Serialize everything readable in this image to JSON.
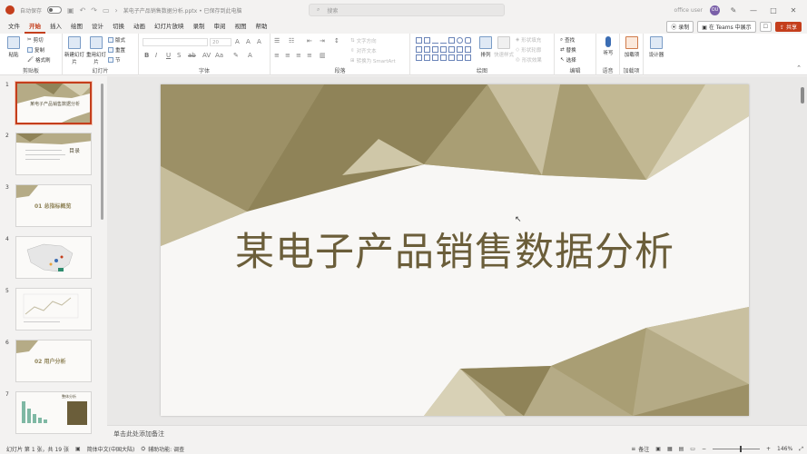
{
  "titlebar": {
    "autosave_label": "自动保存",
    "autosave_state": "关",
    "doc_title": "某电子产品销售数据分析.pptx • 已保存到此电脑",
    "search_placeholder": "搜索",
    "user_name": "office user",
    "user_initials": "OU"
  },
  "tabs": [
    "文件",
    "开始",
    "插入",
    "绘图",
    "设计",
    "切换",
    "动画",
    "幻灯片放映",
    "录制",
    "审阅",
    "视图",
    "帮助"
  ],
  "active_tab": "开始",
  "tab_actions": {
    "record": "录制",
    "teams": "在 Teams 中展示",
    "share": "共享"
  },
  "ribbon": {
    "clipboard": {
      "label": "剪贴板",
      "paste": "粘贴",
      "cut": "剪切",
      "copy": "复制",
      "format_painter": "格式刷"
    },
    "slides": {
      "label": "幻灯片",
      "new_slide": "新建幻灯片",
      "reuse": "重用幻灯片",
      "layout": "版式",
      "reset": "重置",
      "section": "节"
    },
    "font": {
      "label": "字体",
      "size_value": "20"
    },
    "paragraph": {
      "label": "段落",
      "text_direction": "文字方向",
      "align_text": "对齐文本",
      "smartart": "转换为 SmartArt"
    },
    "drawing": {
      "label": "绘图",
      "arrange": "排列",
      "quick_styles": "快速样式",
      "shape_fill": "形状填充",
      "shape_outline": "形状轮廓",
      "shape_effects": "形状效果"
    },
    "editing": {
      "label": "编辑",
      "find": "查找",
      "replace": "替换",
      "select": "选择"
    },
    "voice": {
      "label": "语音",
      "dictate": "听写"
    },
    "addins": {
      "label": "加载项",
      "addins_btn": "加载项"
    },
    "designer": {
      "label": "设计器"
    }
  },
  "thumbnails": [
    {
      "num": "1",
      "text": "某电子产品销售数据分析",
      "selected": true
    },
    {
      "num": "2",
      "text": "目录",
      "selected": false
    },
    {
      "num": "3",
      "text": "01 总指标概览",
      "selected": false
    },
    {
      "num": "4",
      "text": "",
      "selected": false
    },
    {
      "num": "5",
      "text": "",
      "selected": false
    },
    {
      "num": "6",
      "text": "02 用户分析",
      "selected": false
    },
    {
      "num": "7",
      "text": "整体分析",
      "selected": false
    }
  ],
  "slide": {
    "title": "某电子产品销售数据分析"
  },
  "notes_placeholder": "单击此处添加备注",
  "status": {
    "slide_counter": "幻灯片 第 1 张，共 19 张",
    "language": "简体中文(中国大陆)",
    "accessibility": "辅助功能: 调查",
    "notes_btn": "备注",
    "zoom": "146%"
  },
  "colors": {
    "accent": "#c43e1c",
    "slide_title": "#6b5e3a",
    "poly_dark": "#8f8358",
    "poly_mid": "#b5ab86",
    "poly_light": "#d8d1b6"
  }
}
